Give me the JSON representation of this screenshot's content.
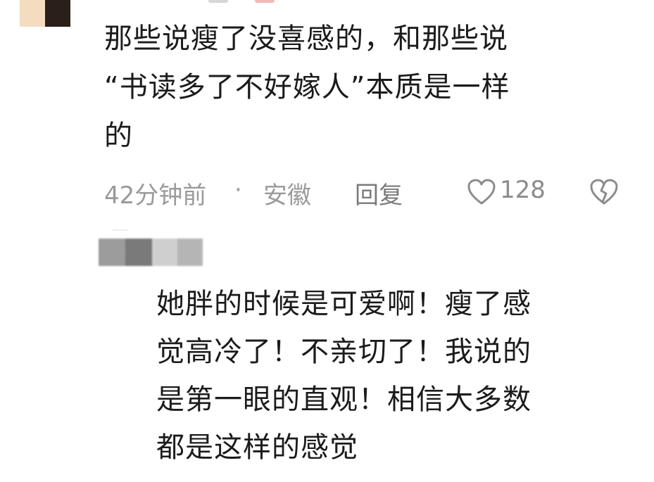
{
  "comment1": {
    "text": "那些说瘦了没喜感的，和那些说\n“书读多了不好嫁人”本质是一样\n的",
    "time": "42分钟前",
    "separator": "·",
    "location": "安徽",
    "reply_label": "回复",
    "like_count": "128",
    "like_icon": "heart-outline-icon",
    "dislike_icon": "broken-heart-icon"
  },
  "comment2": {
    "text": "她胖的时候是可爱啊！瘦了感\n觉高冷了！不亲切了！我说的\n是第一眼的直观！相信大多数\n都是这样的感觉"
  },
  "colors": {
    "meta_text": "#9a9a9a",
    "body_text": "#1b1b1b",
    "background": "#ffffff"
  }
}
